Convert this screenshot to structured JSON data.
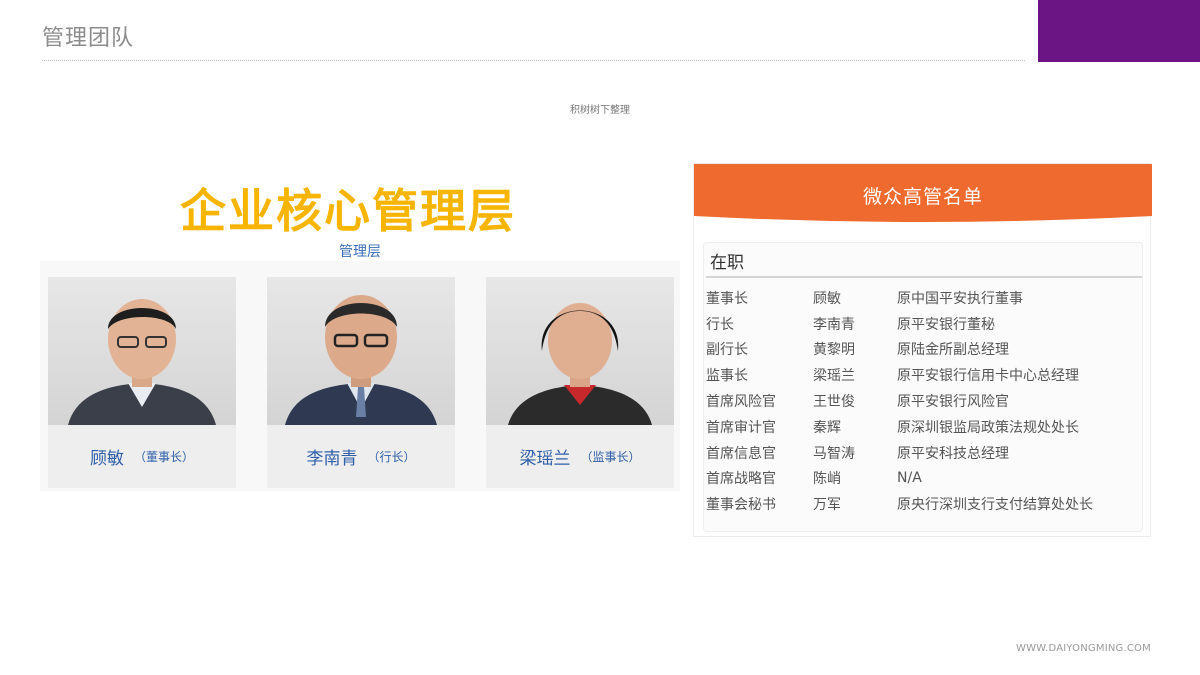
{
  "header": {
    "title": "管理团队"
  },
  "subtitle": "积树树下整理",
  "core": {
    "heading": "企业核心管理层",
    "label": "管理层",
    "people": [
      {
        "name": "顾敏",
        "title": "（董事长）"
      },
      {
        "name": "李南青",
        "title": "（行长）"
      },
      {
        "name": "梁瑶兰",
        "title": "（监事长）"
      }
    ]
  },
  "panel": {
    "title": "微众高管名单",
    "subtitle": "在职",
    "rows": [
      {
        "position": "董事长",
        "name": "顾敏",
        "background": "原中国平安执行董事"
      },
      {
        "position": "行长",
        "name": "李南青",
        "background": "原平安银行董秘"
      },
      {
        "position": "副行长",
        "name": "黄黎明",
        "background": "原陆金所副总经理"
      },
      {
        "position": "监事长",
        "name": "梁瑶兰",
        "background": "原平安银行信用卡中心总经理"
      },
      {
        "position": "首席风险官",
        "name": "王世俊",
        "background": "原平安银行风险官"
      },
      {
        "position": "首席审计官",
        "name": "秦辉",
        "background": "原深圳银监局政策法规处处长"
      },
      {
        "position": "首席信息官",
        "name": "马智涛",
        "background": "原平安科技总经理"
      },
      {
        "position": "首席战略官",
        "name": "陈峭",
        "background": "N/A"
      },
      {
        "position": "董事会秘书",
        "name": "万军",
        "background": "原央行深圳支行支付结算处处长"
      }
    ]
  },
  "footer": {
    "url": "WWW.DAIYONGMING.COM"
  },
  "colors": {
    "accent_purple": "#6b1585",
    "heading_gold": "#f7b500",
    "name_blue": "#2e5fa8",
    "panel_orange": "#ef6a2e"
  }
}
